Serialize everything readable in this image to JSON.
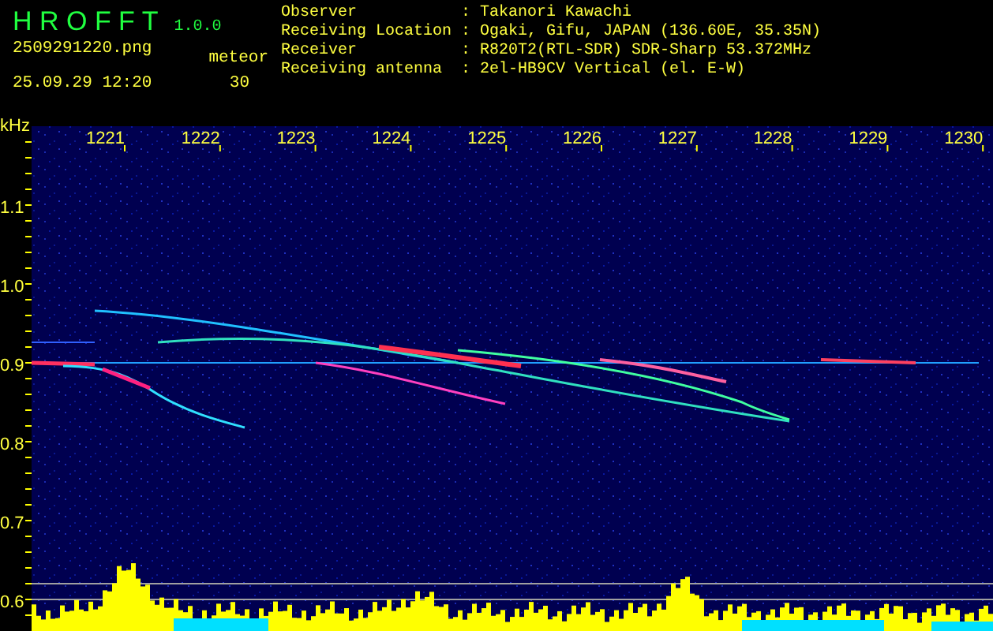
{
  "app": {
    "name": "H R O F F T",
    "version": "1.0.0"
  },
  "file": "2509291220.png",
  "timestamp": "25.09.29 12:20",
  "meteor": {
    "label": "meteor",
    "count": "30"
  },
  "info": [
    {
      "label": "Observer",
      "sep": ":",
      "value": "Takanori Kawachi"
    },
    {
      "label": "Receiving Location",
      "sep": ":",
      "value": "Ogaki, Gifu, JAPAN (136.60E, 35.35N)"
    },
    {
      "label": "Receiver",
      "sep": ":",
      "value": "R820T2(RTL-SDR) SDR-Sharp 53.372MHz"
    },
    {
      "label": "Receiving antenna",
      "sep": ":",
      "value": "2el-HB9CV Vertical (el. E-W)"
    }
  ],
  "spectrogram": {
    "y_unit": "kHz",
    "y_labels": [
      "1.1",
      "1.0",
      "0.9",
      "0.8",
      "0.7",
      "0.6"
    ],
    "x_labels": [
      "1221",
      "1222",
      "1223",
      "1224",
      "1225",
      "1226",
      "1227",
      "1228",
      "1229",
      "1230"
    ]
  }
}
